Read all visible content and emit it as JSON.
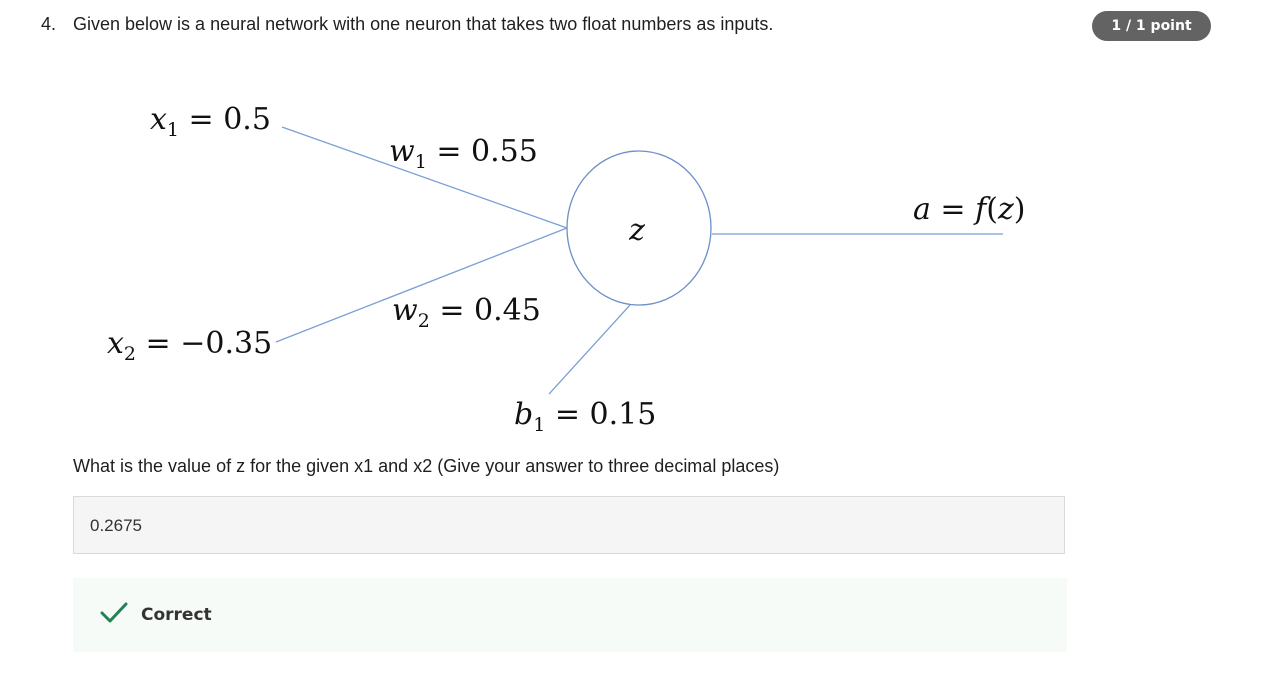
{
  "question": {
    "number": "4.",
    "text": "Given below is a neural network with one neuron that takes two float numbers as inputs.",
    "points": "1 / 1 point"
  },
  "diagram": {
    "x1": {
      "var": "x",
      "sub": "1",
      "rhs": " = 0.5"
    },
    "x2": {
      "var": "x",
      "sub": "2",
      "rhs": " = −0.35"
    },
    "w1": {
      "var": "w",
      "sub": "1",
      "rhs": " = 0.55"
    },
    "w2": {
      "var": "w",
      "sub": "2",
      "rhs": " = 0.45"
    },
    "b1": {
      "var": "b",
      "sub": "1",
      "rhs": " = 0.15"
    },
    "neuron": "z",
    "output": {
      "lhs": "a",
      "mid": " = ",
      "fn": "f",
      "open": "(",
      "arg": "z",
      "close": ")"
    },
    "line_color": "#7b9fd6",
    "circle_color": "#6d8fc8"
  },
  "prompt": "What is the value of z for the given x1 and x2 (Give your answer to three decimal places)",
  "answer": {
    "value": "0.2675"
  },
  "feedback": {
    "icon": "check-icon",
    "label": "Correct",
    "color": "#1f8354"
  }
}
